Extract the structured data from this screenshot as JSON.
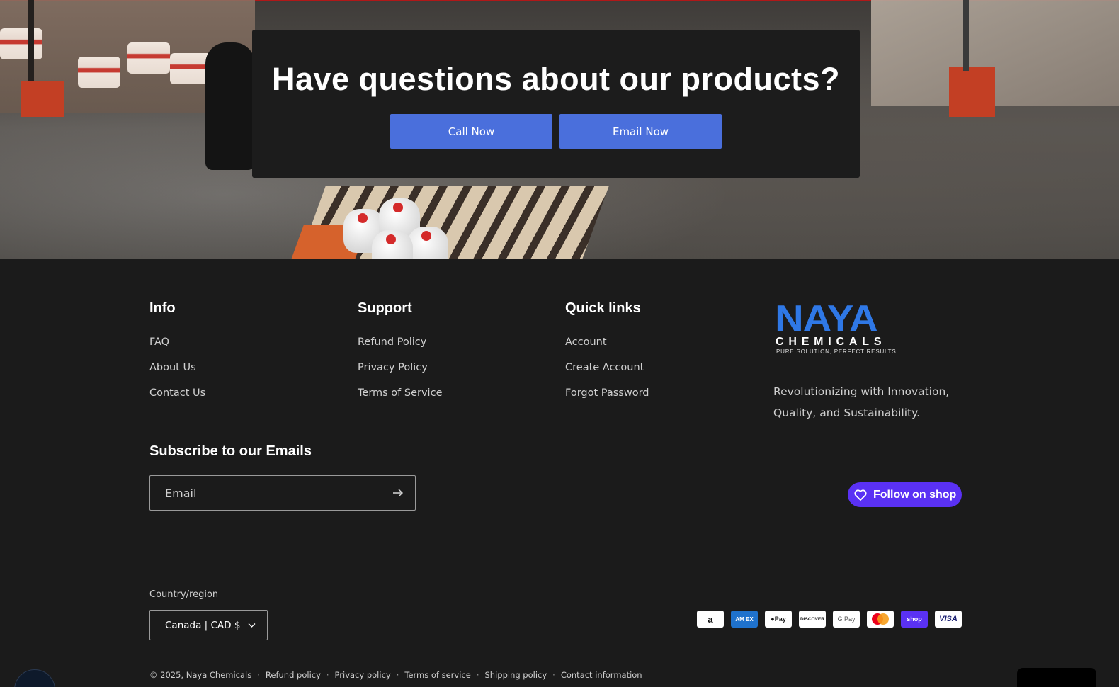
{
  "hero": {
    "heading": "Have questions about our products?",
    "call_label": "Call Now",
    "email_label": "Email Now"
  },
  "footer": {
    "info": {
      "title": "Info",
      "links": [
        "FAQ",
        "About Us",
        "Contact Us"
      ]
    },
    "support": {
      "title": "Support",
      "links": [
        "Refund Policy",
        "Privacy Policy",
        "Terms of Service"
      ]
    },
    "quick_links": {
      "title": "Quick links",
      "links": [
        "Account",
        "Create Account",
        "Forgot Password"
      ]
    },
    "brand": {
      "logo_main": "NAYA",
      "logo_sub": "CHEMICALS",
      "logo_tagline": "PURE SOLUTION, PERFECT RESULTS",
      "tagline": "Revolutionizing with Innovation, Quality, and Sustainability."
    },
    "subscribe": {
      "title": "Subscribe to our Emails",
      "placeholder": "Email"
    },
    "follow_label": "Follow on shop",
    "country": {
      "label": "Country/region",
      "value": "Canada | CAD $"
    },
    "payments": [
      "Amazon",
      "American Express",
      "Apple Pay",
      "Discover",
      "Google Pay",
      "Mastercard",
      "Shop Pay",
      "Visa"
    ],
    "legal": {
      "copyright": "© 2025, Naya Chemicals",
      "links": [
        "Refund policy",
        "Privacy policy",
        "Terms of service",
        "Shipping policy",
        "Contact information"
      ]
    }
  },
  "colors": {
    "accent_button": "#4a6fdc",
    "shop_purple": "#5a31f4",
    "logo_blue": "#2f78e6",
    "background": "#1b1b1b"
  }
}
